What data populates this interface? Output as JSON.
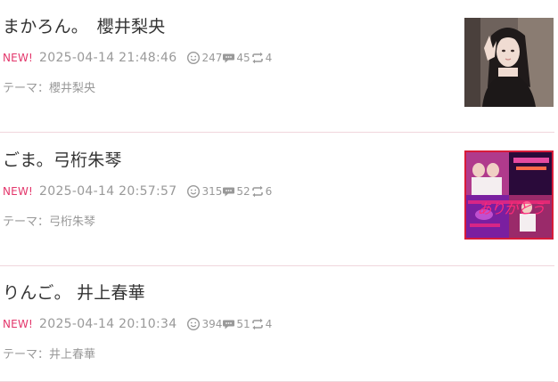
{
  "entries": [
    {
      "title": "まかろん。　櫻井梨央",
      "new_label": "NEW!",
      "date": "2025-04-14 21:48:46",
      "likes": "247",
      "comments": "45",
      "reblogs": "4",
      "theme": "テーマ：櫻井梨央",
      "thumbnail": "photo-portrait"
    },
    {
      "title": "ごま。弓桁朱琴",
      "new_label": "NEW!",
      "date": "2025-04-14 20:57:57",
      "likes": "315",
      "comments": "52",
      "reblogs": "6",
      "theme": "テーマ：弓桁朱琴",
      "thumbnail": "photo-collage",
      "thumbnail_text": "ありがとう"
    },
    {
      "title": "りんご。 井上春華",
      "new_label": "NEW!",
      "date": "2025-04-14 20:10:34",
      "likes": "394",
      "comments": "51",
      "reblogs": "4",
      "theme": "テーマ：井上春華"
    }
  ],
  "icons": {
    "like": "smiley-icon",
    "comment": "speech-bubble-icon",
    "reblog": "reblog-icon"
  },
  "colors": {
    "new": "#e3366b",
    "meta": "#999999",
    "divider": "#f0d6dc"
  }
}
